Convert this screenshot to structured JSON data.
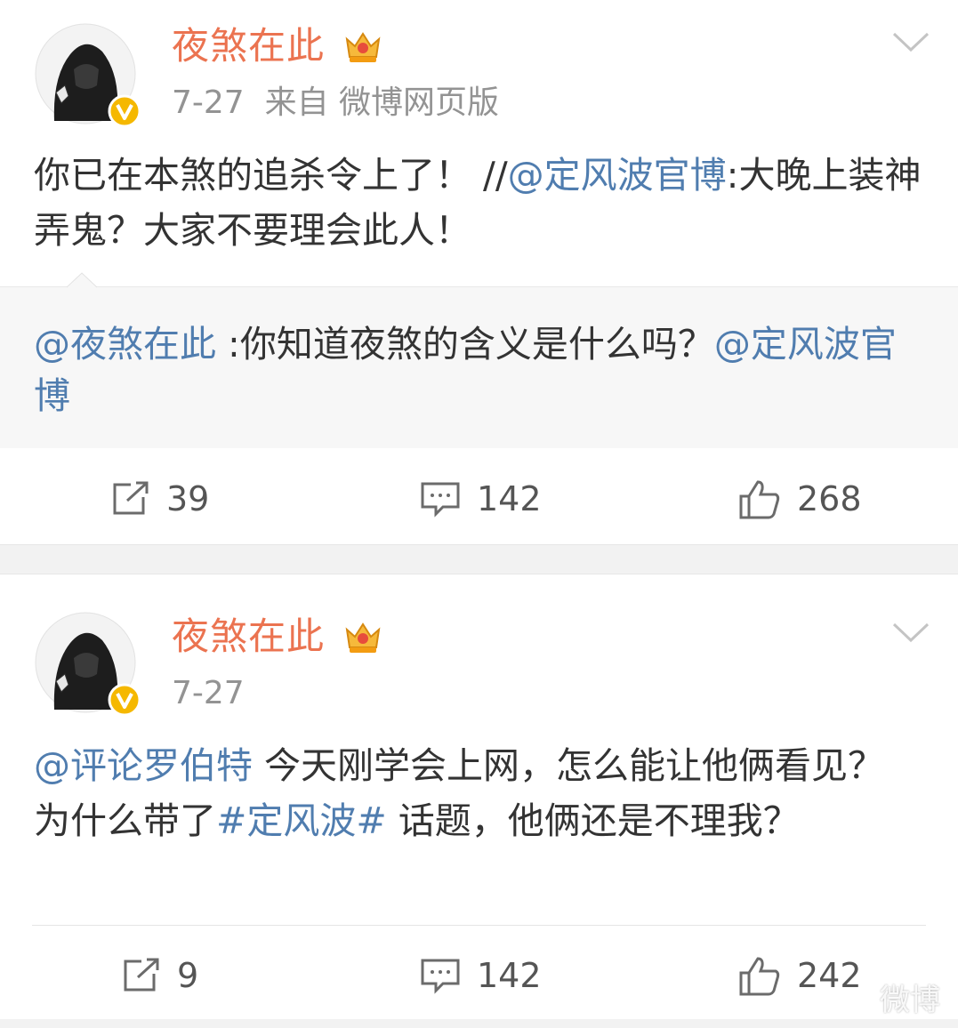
{
  "posts": [
    {
      "username": "夜煞在此",
      "date": "7-27",
      "source": "来自 微博网页版",
      "content": {
        "text1": "你已在本煞的追杀令上了！ //",
        "mention": "@定风波官博",
        "text2": ":大晚上装神弄鬼？大家不要理会此人！"
      },
      "repost": {
        "mention1": "@夜煞在此",
        "text": " :你知道夜煞的含义是什么吗？",
        "mention2": "@定风波官博"
      },
      "actions": {
        "reposts": "39",
        "comments": "142",
        "likes": "268"
      }
    },
    {
      "username": "夜煞在此",
      "date": "7-27",
      "content": {
        "mention": "@评论罗伯特",
        "text1": " 今天刚学会上网，怎么能让他俩看见？为什么带了",
        "topic": "#定风波#",
        "text2": " 话题，他俩还是不理我？"
      },
      "actions": {
        "reposts": "9",
        "comments": "142",
        "likes": "242"
      }
    }
  ],
  "watermark": "微博",
  "icons": {
    "vip": "crown-badge-icon",
    "verified": "verified-v-icon",
    "menu": "chevron-down-icon",
    "repost": "repost-icon",
    "comment": "comment-icon",
    "like": "thumbs-up-icon"
  },
  "colors": {
    "username": "#eb7350",
    "link": "#507daf",
    "meta": "#939393",
    "verified": "#f5b800"
  }
}
